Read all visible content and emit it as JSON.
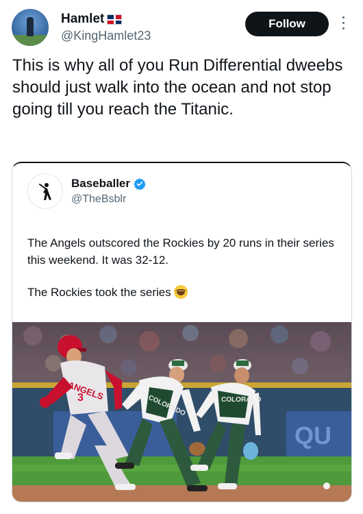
{
  "tweet": {
    "display_name": "Hamlet",
    "flag": "dominican-republic-flag",
    "handle": "@KingHamlet23",
    "follow_label": "Follow",
    "text": "This is why all of you Run Differential dweebs should just walk into the ocean and not stop going till you reach the Titanic."
  },
  "quote": {
    "display_name": "Baseballer",
    "handle": "@TheBsblr",
    "verified_color": "#1d9bf0",
    "paragraph1": "The Angels outscored the Rockies by 20 runs in their series this weekend. It was 32-12.",
    "paragraph2": "The Rockies took the series",
    "emoji": "laughing-crying-emoji",
    "photo": {
      "runner_jersey": "ANGELS",
      "runner_number": "3",
      "fielder_jersey": "COLORADO"
    }
  }
}
